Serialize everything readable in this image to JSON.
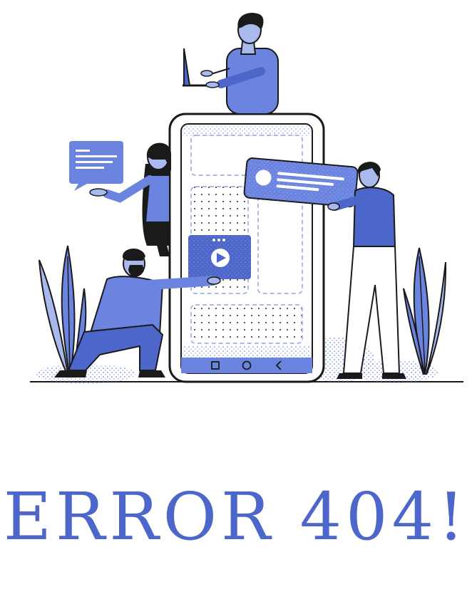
{
  "colors": {
    "accent": "#6b84e0",
    "accent_dark": "#4d66c9",
    "accent_light": "#a9b9ee",
    "ink": "#1a1a1a",
    "background": "#ffffff"
  },
  "icons": {
    "play": "play-icon",
    "nav_square": "square-icon",
    "nav_circle": "circle-icon",
    "nav_back": "chevron-left-icon"
  },
  "heading": {
    "text": "ERROR 404!"
  }
}
